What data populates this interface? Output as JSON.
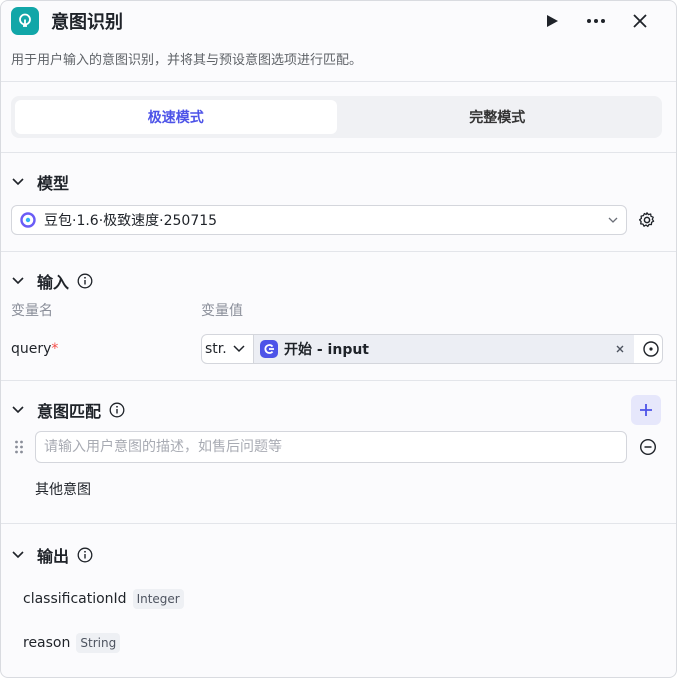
{
  "header": {
    "title": "意图识别",
    "description": "用于用户输入的意图识别，并将其与预设意图选项进行匹配。"
  },
  "mode_tabs": [
    {
      "label": "极速模式",
      "active": true
    },
    {
      "label": "完整模式",
      "active": false
    }
  ],
  "model": {
    "title": "模型",
    "selected": "豆包·1.6·极致速度·250715"
  },
  "input": {
    "title": "输入",
    "col_name": "变量名",
    "col_value": "变量值",
    "var_name": "query",
    "required_mark": "*",
    "type": "str.",
    "ref_label": "开始 - input"
  },
  "intent": {
    "title": "意图匹配",
    "placeholder": "请输入用户意图的描述，如售后问题等",
    "other": "其他意图"
  },
  "output": {
    "title": "输出",
    "fields": [
      {
        "name": "classificationId",
        "type": "Integer"
      },
      {
        "name": "reason",
        "type": "String"
      }
    ]
  },
  "colors": {
    "accent": "#4d53e8",
    "app_icon": "#11a6a8"
  }
}
